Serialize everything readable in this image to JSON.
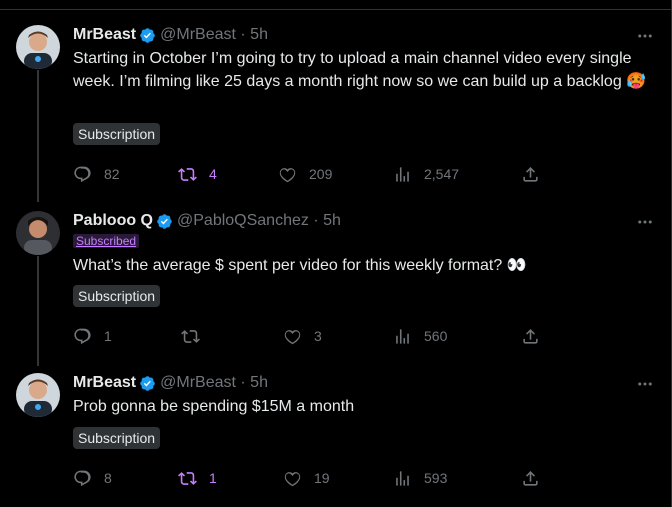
{
  "tweets": [
    {
      "name": "MrBeast",
      "handle": "@MrBeast",
      "time": "5h",
      "subscribed_label": "",
      "text": "Starting in October I’m going to try to upload a main channel video every single week. I’m filming like 25 days a month right now so we can build up a backlog 🥵",
      "subscription_label": "Subscription",
      "replies": "82",
      "reposts": "4",
      "likes": "209",
      "views": "2,547"
    },
    {
      "name": "Pablooo Q",
      "handle": "@PabloQSanchez",
      "time": "5h",
      "subscribed_label": "Subscribed",
      "text": "What’s the average $ spent per video for this weekly format? 👀",
      "subscription_label": "Subscription",
      "replies": "1",
      "reposts": "",
      "likes": "3",
      "views": "560"
    },
    {
      "name": "MrBeast",
      "handle": "@MrBeast",
      "time": "5h",
      "subscribed_label": "",
      "text": "Prob gonna be spending $15M a month",
      "subscription_label": "Subscription",
      "replies": "8",
      "reposts": "1",
      "likes": "19",
      "views": "593"
    }
  ],
  "colors": {
    "background": "#000000",
    "verified": "#1d9bf0",
    "subscription_accent": "#c77dff",
    "muted": "#71767b"
  },
  "icons": [
    "verified-badge-icon",
    "more-icon",
    "reply-icon",
    "repost-icon",
    "like-icon",
    "views-icon",
    "share-icon"
  ]
}
